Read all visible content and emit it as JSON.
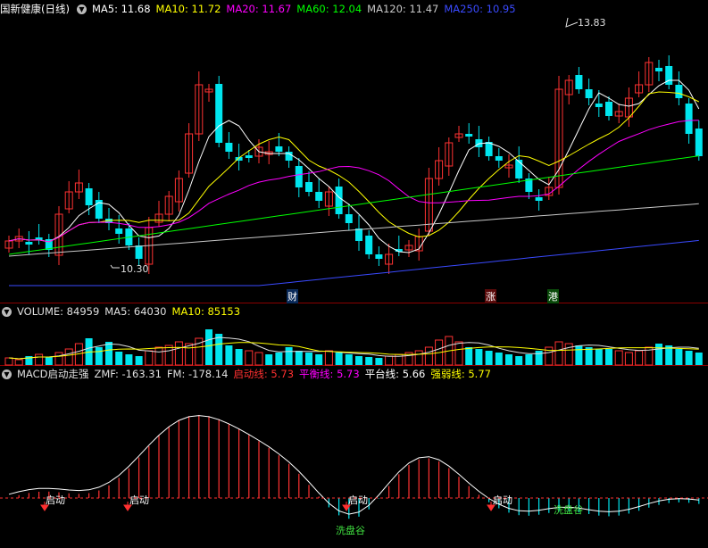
{
  "price_panel": {
    "title": "国新健康(日线)",
    "indicators": [
      {
        "label": "MA5: 11.68",
        "color": "#ffffff"
      },
      {
        "label": "MA10: 11.72",
        "color": "#ffff00"
      },
      {
        "label": "MA20: 11.67",
        "color": "#ff00ff"
      },
      {
        "label": "MA60: 12.04",
        "color": "#00ff00"
      },
      {
        "label": "MA120: 11.47",
        "color": "#c8c8c8"
      },
      {
        "label": "MA250: 10.95",
        "color": "#3a4aff"
      }
    ],
    "high_label": "13.83",
    "low_label": "10.30",
    "event_marks": [
      {
        "text": "财",
        "color": "#4aa0ff"
      },
      {
        "text": "涨",
        "color": "#ff6060"
      },
      {
        "text": "港",
        "color": "#40e040"
      }
    ]
  },
  "volume_panel": {
    "indicators": [
      {
        "label": "VOLUME: 84959",
        "color": "#e0e0e0"
      },
      {
        "label": "MA5: 64030",
        "color": "#e0e0e0"
      },
      {
        "label": "MA10: 85153",
        "color": "#ffff00"
      }
    ]
  },
  "macd_panel": {
    "indicators": [
      {
        "label": "MACD启动走强",
        "color": "#e0e0e0"
      },
      {
        "label": "ZMF: -163.31",
        "color": "#e0e0e0"
      },
      {
        "label": "FM: -178.14",
        "color": "#e0e0e0"
      },
      {
        "label": "启动线: 5.73",
        "color": "#ff3030"
      },
      {
        "label": "平衡线: 5.73",
        "color": "#ff00ff"
      },
      {
        "label": "平台线: 5.66",
        "color": "#ffffff"
      },
      {
        "label": "强弱线: 5.77",
        "color": "#ffff00"
      }
    ],
    "start_label": "启动",
    "valley_label": "洗盘谷"
  },
  "colors": {
    "up": "#ff3232",
    "down": "#00e5ee",
    "separator": "#8b0000",
    "background": "#000000"
  }
}
